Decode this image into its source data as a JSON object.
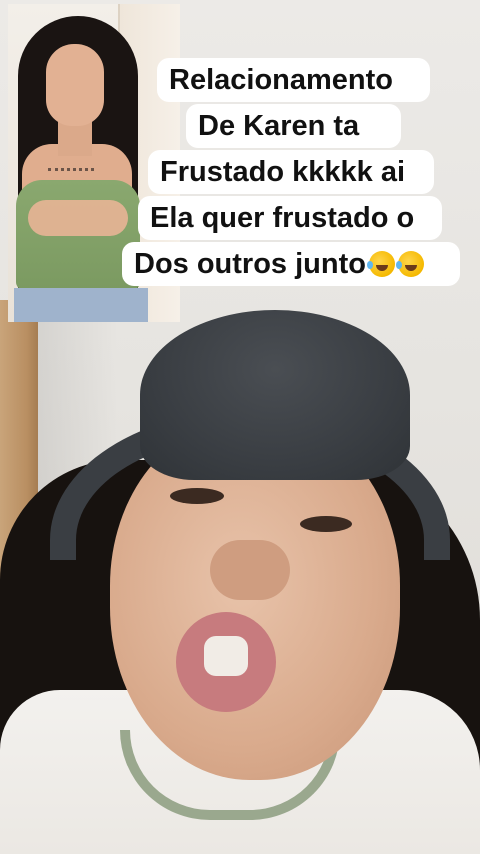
{
  "caption": {
    "lines": [
      "Relacionamento",
      "De Karen ta",
      "Frustado kkkkk ai",
      "Ela quer frustado o",
      "Dos outros junto"
    ],
    "trailing_emoji": "rolling-on-floor-laughing-icon",
    "background_color": "#ffffff",
    "text_color": "#111111"
  },
  "inset_photo": {
    "top_color": "#8aa86f"
  },
  "subject": {
    "hat_color": "#3a3e43"
  }
}
